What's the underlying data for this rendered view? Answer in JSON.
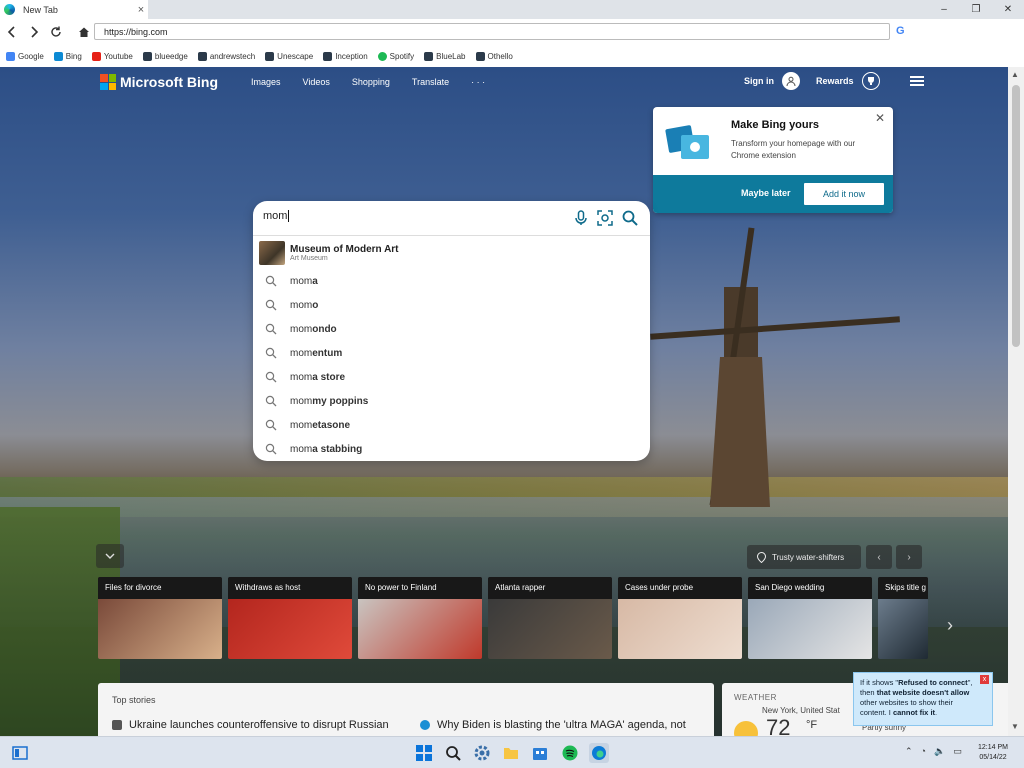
{
  "browser": {
    "tab_title": "New Tab",
    "tab_close": "×",
    "url": "https://bing.com",
    "window_controls": {
      "minimize": "–",
      "maximize": "❐",
      "close": "✕"
    },
    "bookmarks": [
      {
        "label": "Google",
        "color": "#4285f4"
      },
      {
        "label": "Bing",
        "color": "#0c8ad4"
      },
      {
        "label": "Youtube",
        "color": "#e62117"
      },
      {
        "label": "blueedge",
        "color": "#2b3a4a"
      },
      {
        "label": "andrewstech",
        "color": "#2b3a4a"
      },
      {
        "label": "Unescape",
        "color": "#2b3a4a"
      },
      {
        "label": "Inception",
        "color": "#2b3a4a"
      },
      {
        "label": "Spotify",
        "color": "#1db954"
      },
      {
        "label": "BlueLab",
        "color": "#2b3a4a"
      },
      {
        "label": "Othello",
        "color": "#2b3a4a"
      }
    ]
  },
  "bing": {
    "logo_text": "Microsoft Bing",
    "nav": [
      "Images",
      "Videos",
      "Shopping",
      "Translate",
      "· · ·"
    ],
    "sign_in": "Sign in",
    "rewards": "Rewards"
  },
  "promo": {
    "title": "Make Bing yours",
    "description": "Transform your homepage with our Chrome extension",
    "close": "✕",
    "maybe_later": "Maybe later",
    "add_it_now": "Add it now",
    "bar_color": "#0e7a9c"
  },
  "search": {
    "query": "mom",
    "top_suggestion": {
      "name": "Museum of Modern Art",
      "subtitle": "Art Museum"
    },
    "suggestions": [
      {
        "prefix": "mom",
        "suffix": "a"
      },
      {
        "prefix": "mom",
        "suffix": "o"
      },
      {
        "prefix": "mom",
        "suffix": "ondo"
      },
      {
        "prefix": "mom",
        "suffix": "entum"
      },
      {
        "prefix": "mom",
        "suffix": "a store"
      },
      {
        "prefix": "mom",
        "suffix": "my poppins"
      },
      {
        "prefix": "mom",
        "suffix": "etasone"
      },
      {
        "prefix": "mom",
        "suffix": "a stabbing"
      }
    ]
  },
  "carousel": {
    "pin_label": "Trusty water-shifters",
    "cards": [
      {
        "caption": "Files for divorce",
        "color": "#7a4a3a"
      },
      {
        "caption": "Withdraws as host",
        "color": "#b3261e"
      },
      {
        "caption": "No power to Finland",
        "color": "#c9c4c0"
      },
      {
        "caption": "Atlanta rapper",
        "color": "#3a3a3a"
      },
      {
        "caption": "Cases under probe",
        "color": "#d7b9a5"
      },
      {
        "caption": "San Diego wedding",
        "color": "#9aa8b8"
      },
      {
        "caption": "Skips title g",
        "color": "#6c7c8c"
      }
    ]
  },
  "top_stories": {
    "title": "Top stories",
    "items": [
      "Ukraine launches counteroffensive to disrupt Russian",
      "Why Biden is blasting the 'ultra MAGA' agenda, not"
    ]
  },
  "weather": {
    "title": "WEATHER",
    "location": "New York, United Stat",
    "temp": "72",
    "unit": "°F",
    "condition": "Partly sunny"
  },
  "tooltip": {
    "l1_pre": "If it shows \"",
    "l1_bold": "Refused to connect",
    "l1_post": "\",",
    "l2_pre": "then ",
    "l2_bold": "that website doesn't allow",
    "l3": "other websites to show their",
    "l4_pre": "content. I ",
    "l4_bold": "cannot fix it",
    "l4_post": ".",
    "close": "x"
  },
  "taskbar": {
    "time": "12:14 PM",
    "date": "05/14/22"
  }
}
